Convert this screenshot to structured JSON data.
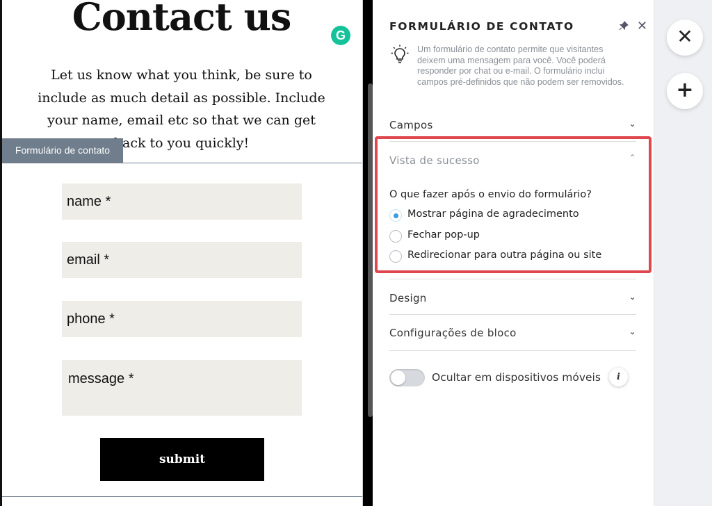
{
  "preview": {
    "title": "Contact us",
    "intro": "Let us know what you think, be sure to include as much detail as possible. Include your name, email etc so that we can get back to you quickly!",
    "grammarly_glyph": "G",
    "block_tag": "Formulário de contato",
    "fields": [
      {
        "placeholder": "name *"
      },
      {
        "placeholder": "email *"
      },
      {
        "placeholder": "phone *"
      },
      {
        "placeholder": "message *"
      }
    ],
    "submit_label": "submit"
  },
  "panel": {
    "title": "FORMULÁRIO DE CONTATO",
    "pin_icon": "pin-icon",
    "close_icon": "close-icon",
    "description": "Um formulário de contato permite que visitantes deixem uma mensagem para você. Você poderá responder por chat ou e-mail. O formulário inclui campos pré-definidos que não podem ser removidos.",
    "sections": {
      "campos": "Campos",
      "vista": "Vista de sucesso",
      "design": "Design",
      "config": "Configurações de bloco"
    },
    "success_question": "O que fazer após o envio do formulário?",
    "success_options": [
      {
        "label": "Mostrar página de agradecimento",
        "selected": true
      },
      {
        "label": "Fechar pop-up",
        "selected": false
      },
      {
        "label": "Redirecionar para outra página ou site",
        "selected": false
      }
    ],
    "toggle_label": "Ocultar em dispositivos móveis",
    "toggle_on": false,
    "info_glyph": "i",
    "highlight_color": "#e0464e",
    "accent_color": "#3a9be0"
  },
  "rail": {
    "close_glyph": "✕",
    "add_glyph": "+"
  }
}
